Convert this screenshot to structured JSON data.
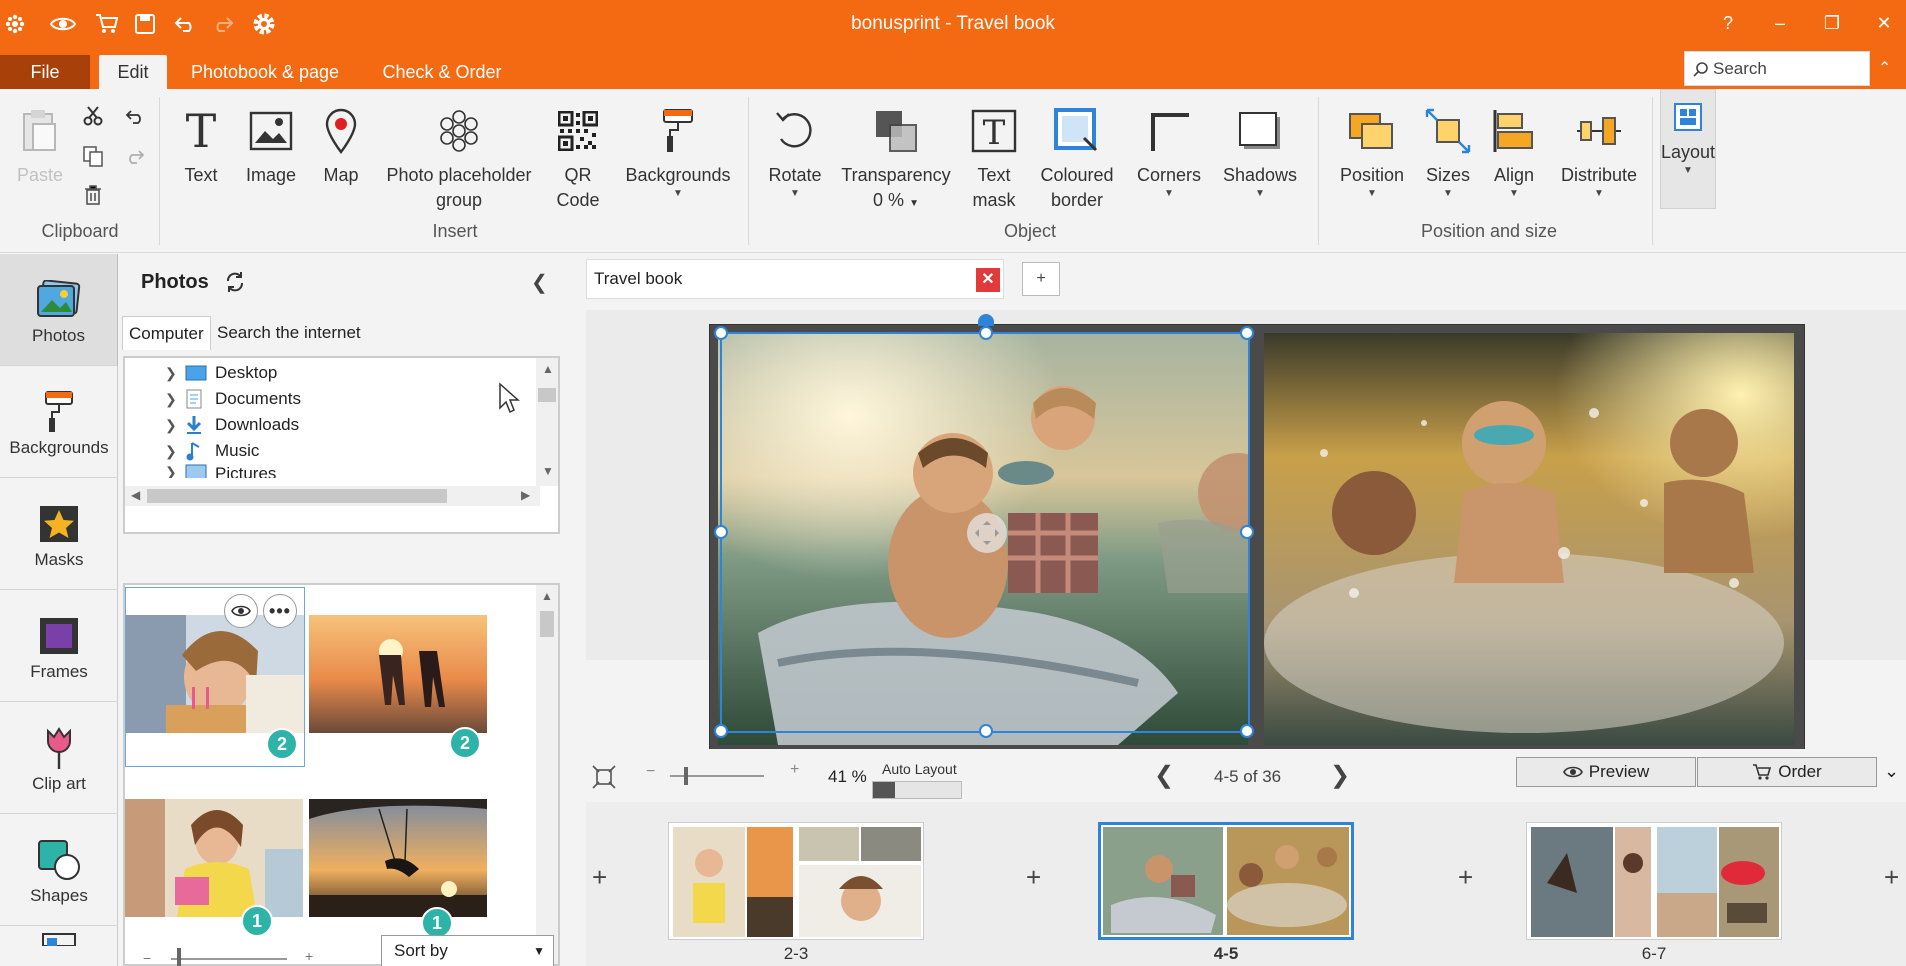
{
  "app": {
    "title": "bonusprint - Travel book"
  },
  "titlebar": {
    "help": "?",
    "minimize": "–",
    "restore": "❐",
    "close": "✕"
  },
  "menu": {
    "file": "File",
    "edit": "Edit",
    "photobook": "Photobook & page",
    "check_order": "Check & Order"
  },
  "search": {
    "placeholder": "Search"
  },
  "ribbon": {
    "clipboard": {
      "paste": "Paste",
      "group": "Clipboard"
    },
    "insert": {
      "text": "Text",
      "image": "Image",
      "map": "Map",
      "placeholder": "Photo placeholder group",
      "qr": "QR Code",
      "backgrounds": "Backgrounds",
      "group": "Insert"
    },
    "object": {
      "rotate": "Rotate",
      "transparency": "Transparency",
      "transparency_value": "0 %",
      "text_mask": "Text mask",
      "coloured_border": "Coloured border",
      "corners": "Corners",
      "shadows": "Shadows",
      "group": "Object"
    },
    "position": {
      "position": "Position",
      "sizes": "Sizes",
      "align": "Align",
      "distribute": "Distribute",
      "group": "Position and size"
    },
    "layout": "Layout"
  },
  "nav": [
    {
      "label": "Photos",
      "icon": "photos-icon"
    },
    {
      "label": "Backgrounds",
      "icon": "paint-roller-icon"
    },
    {
      "label": "Masks",
      "icon": "star-mask-icon"
    },
    {
      "label": "Frames",
      "icon": "frame-icon"
    },
    {
      "label": "Clip art",
      "icon": "tulip-icon"
    },
    {
      "label": "Shapes",
      "icon": "shapes-icon"
    }
  ],
  "photos_panel": {
    "title": "Photos",
    "tabs": [
      "Computer",
      "Search the internet"
    ],
    "tree": [
      "Desktop",
      "Documents",
      "Downloads",
      "Music",
      "Pictures"
    ],
    "thumbs": [
      {
        "subject": "girl blowing birthday candles",
        "count": "2"
      },
      {
        "subject": "couple running on beach at sunset",
        "count": "2"
      },
      {
        "subject": "girl with birthday gift",
        "count": "1"
      },
      {
        "subject": "person on swing at sunset",
        "count": "1"
      }
    ],
    "sort": "Sort by"
  },
  "document": {
    "tab": "Travel book",
    "tab_add": "+",
    "zoom": "41 %",
    "auto_layout": "Auto Layout",
    "auto_layout_level": 0.25,
    "page_count": "4-5 of 36",
    "preview": "Preview",
    "order": "Order"
  },
  "filmstrip": [
    {
      "label": "2-3"
    },
    {
      "label": "4-5",
      "selected": true
    },
    {
      "label": "6-7"
    }
  ],
  "colors": {
    "brand": "#f46a12",
    "selection": "#2d84d8",
    "badge": "#2eb3a9"
  }
}
